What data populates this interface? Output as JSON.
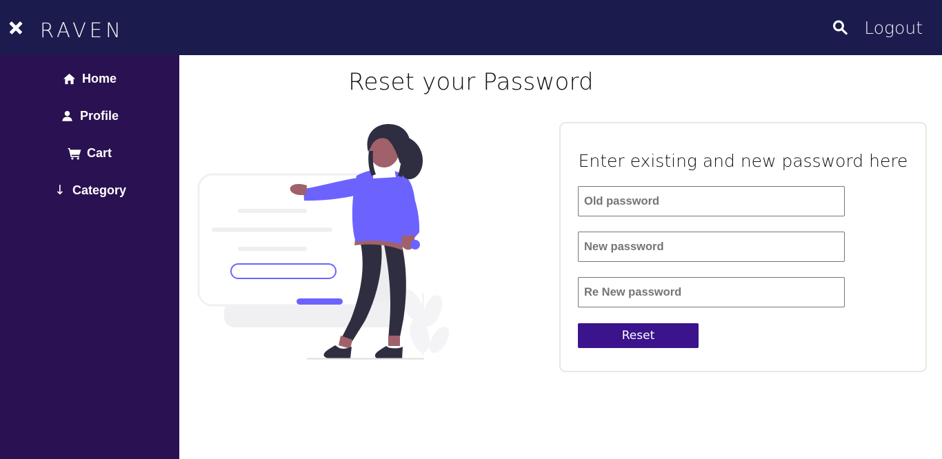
{
  "header": {
    "close_icon": "close-icon",
    "brand": "Raven",
    "search_icon": "search-icon",
    "logout_label": "Logout"
  },
  "sidebar": {
    "items": [
      {
        "label": "Home",
        "icon": "home-icon"
      },
      {
        "label": "Profile",
        "icon": "user-icon"
      },
      {
        "label": "Cart",
        "icon": "shopping-cart-icon"
      },
      {
        "label": "Category",
        "icon": "arrow-down-icon",
        "glyph": "↓"
      }
    ]
  },
  "main": {
    "page_title": "Reset your Password",
    "illustration": {
      "name": "reset-password-illustration",
      "colors": {
        "sweater": "#6c63ff",
        "hair": "#2f2e41",
        "pants": "#2f2e41",
        "skin": "#a0616a",
        "card": "#ffffff",
        "card_outline": "#f2f2f2",
        "shadow": "#eeeeee",
        "accent": "#6c63ff"
      }
    },
    "form": {
      "heading": "Enter existing and new password here",
      "fields": [
        {
          "name": "old-password",
          "placeholder": "Old password",
          "value": ""
        },
        {
          "name": "new-password",
          "placeholder": "New password",
          "value": ""
        },
        {
          "name": "re-new-password",
          "placeholder": "Re New password",
          "value": ""
        }
      ],
      "submit_label": "Reset"
    }
  },
  "theme": {
    "header_bg": "#1c1b4e",
    "sidebar_bg": "#2a1152",
    "button_bg": "#3b138c",
    "card_border": "#e8e8e0",
    "input_border": "#767676",
    "page_bg": "#ffffff"
  }
}
